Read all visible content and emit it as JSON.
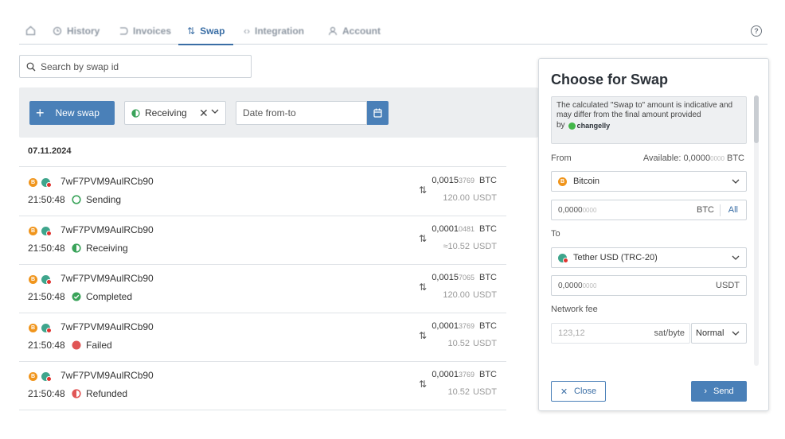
{
  "nav": {
    "items": [
      {
        "label": "",
        "icon": "home-icon"
      },
      {
        "label": "History",
        "icon": "history-icon"
      },
      {
        "label": "Invoices",
        "icon": "invoice-icon"
      },
      {
        "label": "Swap",
        "icon": "swap-icon",
        "active": true
      },
      {
        "label": "Integration",
        "icon": "code-icon"
      },
      {
        "label": "Account",
        "icon": "user-icon"
      }
    ],
    "help_label": "?"
  },
  "search": {
    "placeholder": "Search by swap id"
  },
  "filters": {
    "new_swap_label": "New swap",
    "status_selected": "Receiving",
    "date_placeholder": "Date from-to"
  },
  "list": {
    "date_header": "07.11.2024",
    "rows": [
      {
        "id": "7wF7PVM9AulRCb90",
        "time": "21:50:48",
        "status": "Sending",
        "amount_main": "0,0015",
        "amount_dim": "3769",
        "amount_cur": "BTC",
        "amount2": "120.00",
        "amount2_cur": "USDT"
      },
      {
        "id": "7wF7PVM9AulRCb90",
        "time": "21:50:48",
        "status": "Receiving",
        "amount_main": "0,0001",
        "amount_dim": "0481",
        "amount_cur": "BTC",
        "amount2": "≈10.52",
        "amount2_cur": "USDT"
      },
      {
        "id": "7wF7PVM9AulRCb90",
        "time": "21:50:48",
        "status": "Completed",
        "amount_main": "0,0015",
        "amount_dim": "7065",
        "amount_cur": "BTC",
        "amount2": "120.00",
        "amount2_cur": "USDT"
      },
      {
        "id": "7wF7PVM9AulRCb90",
        "time": "21:50:48",
        "status": "Failed",
        "amount_main": "0,0001",
        "amount_dim": "3769",
        "amount_cur": "BTC",
        "amount2": "10.52",
        "amount2_cur": "USDT"
      },
      {
        "id": "7wF7PVM9AulRCb90",
        "time": "21:50:48",
        "status": "Refunded",
        "amount_main": "0,0001",
        "amount_dim": "3769",
        "amount_cur": "BTC",
        "amount2": "10.52",
        "amount2_cur": "USDT"
      }
    ]
  },
  "panel": {
    "title": "Choose for Swap",
    "notice": "The calculated \"Swap to\" amount is indicative and may differ from the final amount provided",
    "notice_by": "by",
    "brand": "changelly",
    "from_label": "From",
    "available_label": "Available:",
    "available_main": "0,0000",
    "available_dim": "0000",
    "available_cur": "BTC",
    "from_coin": "Bitcoin",
    "from_amount_main": "0,0000",
    "from_amount_dim": "0000",
    "from_cur": "BTC",
    "all_label": "All",
    "to_label": "To",
    "to_coin": "Tether USD (TRC-20)",
    "to_amount_main": "0,0000",
    "to_amount_dim": "0000",
    "to_cur": "USDT",
    "fee_label": "Network fee",
    "fee_placeholder": "123,12",
    "fee_unit": "sat/byte",
    "fee_speed": "Normal",
    "close_label": "Close",
    "send_label": "Send"
  },
  "colors": {
    "accent": "#4a80b8",
    "sending": "#3aa35a",
    "receiving": "#3aa35a",
    "completed": "#3aa35a",
    "failed": "#e05555",
    "refunded": "#e05555"
  }
}
